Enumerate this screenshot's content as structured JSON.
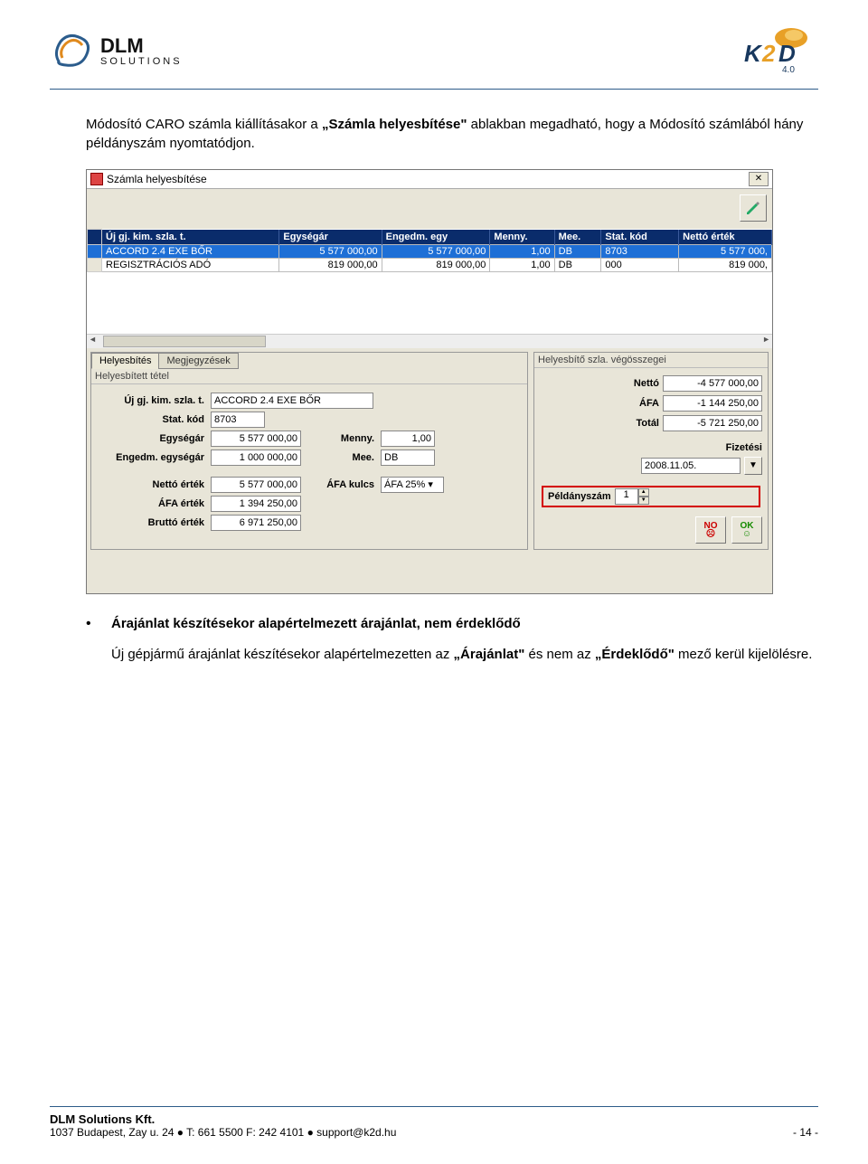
{
  "header": {
    "brand_main": "DLM",
    "brand_sub": "SOLUTIONS",
    "brand_right_main": "K2D",
    "brand_right_sub": "4.0"
  },
  "intro": {
    "para1_pre": "Módosító CARO számla kiállításakor a ",
    "para1_bold1": "„Számla helyesbítése\"",
    "para1_mid": " ablakban megadható, hogy a Módosító számlából hány példányszám nyomtatódjon."
  },
  "screenshot": {
    "title": "Számla helyesbítése",
    "close": "✕",
    "headers": [
      "",
      "Új gj. kim. szla. t.",
      "Egységár",
      "Engedm. egy",
      "Menny.",
      "Mee.",
      "Stat. kód",
      "Nettó érték"
    ],
    "row1": [
      "",
      "ACCORD 2.4 EXE BŐR",
      "5 577 000,00",
      "5 577 000,00",
      "1,00",
      "DB",
      "8703",
      "5 577 000,"
    ],
    "row2": [
      "",
      "REGISZTRÁCIÓS ADÓ",
      "819 000,00",
      "819 000,00",
      "1,00",
      "DB",
      "000",
      "819 000,"
    ],
    "tabs": {
      "active": "Helyesbítés",
      "inactive": "Megjegyzések"
    },
    "left_fieldset": "Helyesbített tétel",
    "right_fieldset": "Helyesbítő szla. végösszegei",
    "fields": {
      "uj_gj_label": "Új gj. kim. szla. t.",
      "uj_gj_val": "ACCORD 2.4 EXE BŐR",
      "statkod_label": "Stat. kód",
      "statkod_val": "8703",
      "egysegar_label": "Egységár",
      "egysegar_val": "5 577 000,00",
      "menny_label": "Menny.",
      "menny_val": "1,00",
      "engedm_label": "Engedm. egységár",
      "engedm_val": "1 000 000,00",
      "mee_label": "Mee.",
      "mee_val": "DB",
      "netto_label": "Nettó érték",
      "netto_val": "5 577 000,00",
      "afakulcs_label": "ÁFA kulcs",
      "afakulcs_val": "ÁFA 25%",
      "afa_label": "ÁFA érték",
      "afa_val": "1 394 250,00",
      "brutto_label": "Bruttó érték",
      "brutto_val": "6 971 250,00"
    },
    "totals": {
      "netto_label": "Nettó",
      "netto_val": "-4 577 000,00",
      "afa_label": "ÁFA",
      "afa_val": "-1 144 250,00",
      "total_label": "Totál",
      "total_val": "-5 721 250,00",
      "fiz_label": "Fizetési",
      "fiz_date": "2008.11.05."
    },
    "peldany_label": "Példányszám",
    "peldany_val": "1",
    "no_label": "NO",
    "ok_label": "OK"
  },
  "bullet": {
    "title": "Árajánlat készítésekor alapértelmezett árajánlat, nem érdeklődő",
    "body_pre": "Új gépjármű árajánlat készítésekor alapértelmezetten az ",
    "body_b1": "„Árajánlat\"",
    "body_mid": " és nem az ",
    "body_b2": "„Érdeklődő\"",
    "body_end": " mező kerül kijelölésre."
  },
  "footer": {
    "company": "DLM Solutions Kft.",
    "address": "1037 Budapest, Zay u. 24  ●  T: 661 5500  F: 242 4101  ●  support@k2d.hu",
    "pagenum": "- 14 -"
  }
}
